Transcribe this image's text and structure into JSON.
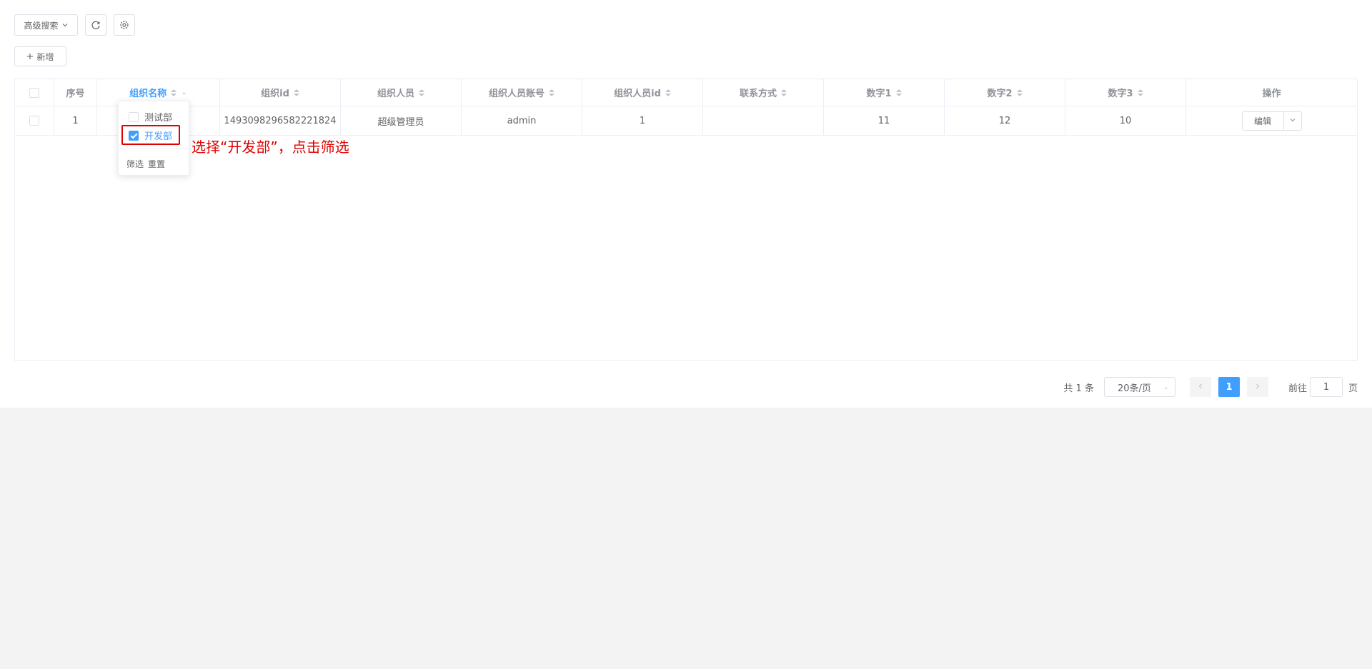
{
  "toolbar": {
    "advanced_search_label": "高级搜索",
    "refresh_icon": "refresh-icon",
    "settings_icon": "gear-icon",
    "add_label": "新增"
  },
  "table": {
    "columns": [
      "序号",
      "组织名称",
      "组织id",
      "组织人员",
      "组织人员账号",
      "组织人员id",
      "联系方式",
      "数字1",
      "数字2",
      "数字3",
      "操作"
    ],
    "rows": [
      {
        "index": "1",
        "org_name": "",
        "org_id": "1493098296582221824",
        "member": "超级管理员",
        "account": "admin",
        "member_id": "1",
        "contact": "",
        "num1": "11",
        "num2": "12",
        "num3": "10",
        "action": "编辑"
      }
    ]
  },
  "filter_popup": {
    "options": [
      {
        "label": "测试部",
        "checked": false
      },
      {
        "label": "开发部",
        "checked": true
      }
    ],
    "filter_label": "筛选",
    "reset_label": "重置"
  },
  "annotation": {
    "text": "选择“开发部”，点击筛选",
    "color": "#e00000"
  },
  "pagination": {
    "total_text": "共 1 条",
    "page_size": "20条/页",
    "current_page": "1",
    "goto_prefix": "前往",
    "goto_value": "1",
    "goto_suffix": "页"
  },
  "colors": {
    "primary": "#409eff",
    "highlight": "#e00000"
  }
}
